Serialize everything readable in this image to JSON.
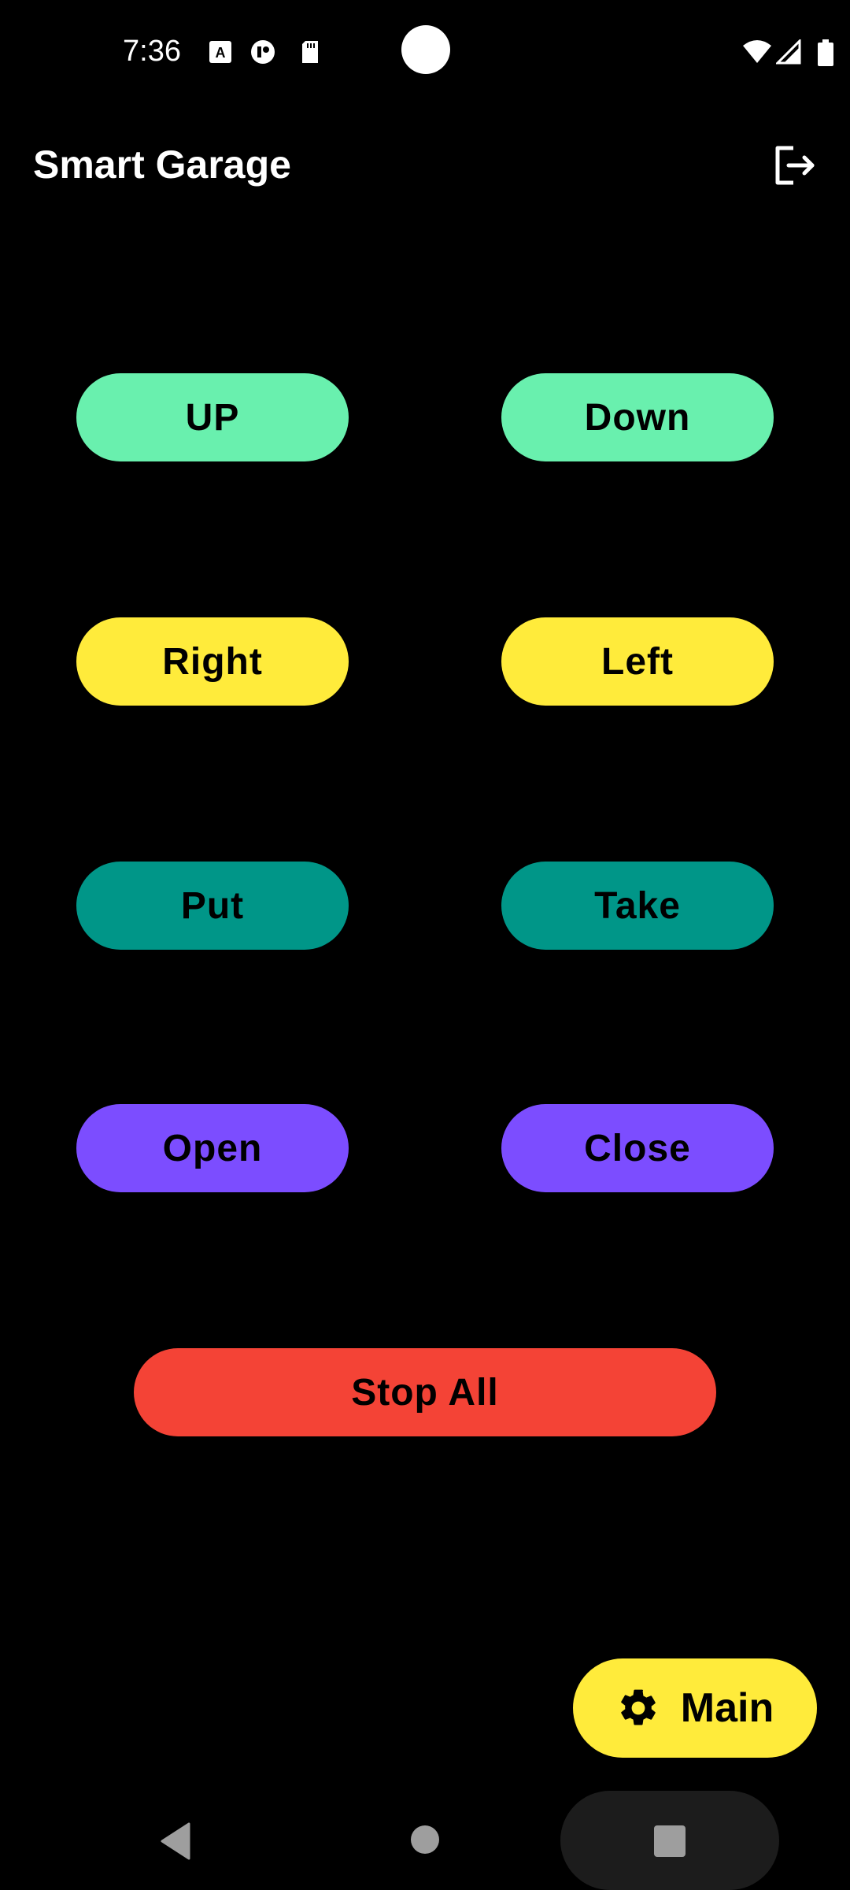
{
  "status_bar": {
    "time": "7:36",
    "left_icons": [
      "keyboard-a-icon",
      "app-notification-icon",
      "sd-card-icon"
    ],
    "right_icons": [
      "wifi-icon",
      "signal-icon",
      "battery-icon"
    ]
  },
  "app_bar": {
    "title": "Smart Garage",
    "logout_icon": "logout-icon"
  },
  "controls": {
    "up": "UP",
    "down": "Down",
    "right": "Right",
    "left": "Left",
    "put": "Put",
    "take": "Take",
    "open": "Open",
    "close": "Close",
    "stop_all": "Stop All"
  },
  "colors": {
    "green": "#69F0AE",
    "yellow": "#FFEB3B",
    "teal": "#009688",
    "purple": "#7C4DFF",
    "red": "#F44336"
  },
  "fab": {
    "label": "Main",
    "icon": "gear-icon"
  },
  "nav_bar": {
    "icons": [
      "back-icon",
      "home-icon",
      "recents-icon"
    ]
  }
}
